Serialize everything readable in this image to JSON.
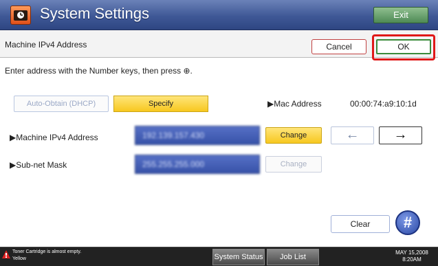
{
  "title": "System Settings",
  "exit_label": "Exit",
  "header": {
    "label": "Machine IPv4 Address",
    "cancel_label": "Cancel",
    "ok_label": "OK"
  },
  "instruction": "Enter address with the Number keys, then press ⊕.",
  "mode": {
    "auto_label": "Auto-Obtain (DHCP)",
    "specify_label": "Specify"
  },
  "mac": {
    "label": "▶Mac Address",
    "value": "00:00:74:a9:10:1d"
  },
  "ipv4": {
    "label": "▶Machine IPv4 Address",
    "value": "192.139.157.430",
    "change_label": "Change"
  },
  "subnet": {
    "label": "▶Sub-net Mask",
    "value": "255.255.255.000",
    "change_label": "Change"
  },
  "arrows": {
    "left": "←",
    "right": "→"
  },
  "clear_label": "Clear",
  "hash_label": "#",
  "statusbar": {
    "message_line1": "Toner Cartridge is almost empty.",
    "message_line2": "Yellow",
    "system_status_label": "System Status",
    "job_list_label": "Job List",
    "date": "MAY 15,2008",
    "time": "8:20AM"
  },
  "colors": {
    "title_bar": "#3f5896",
    "accent_yellow": "#f7c81f",
    "ok_highlight": "#e01818",
    "field_blue": "#3752a8"
  }
}
